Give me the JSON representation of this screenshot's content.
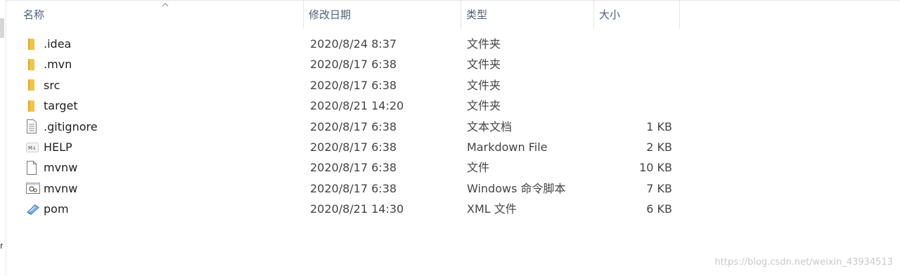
{
  "columns": {
    "name": "名称",
    "modified": "修改日期",
    "type": "类型",
    "size": "大小"
  },
  "files": [
    {
      "name": ".idea",
      "modified": "2020/8/24 8:37",
      "type": "文件夹",
      "size": "",
      "icon": "folder-icon"
    },
    {
      "name": ".mvn",
      "modified": "2020/8/17 6:38",
      "type": "文件夹",
      "size": "",
      "icon": "folder-icon"
    },
    {
      "name": "src",
      "modified": "2020/8/17 6:38",
      "type": "文件夹",
      "size": "",
      "icon": "folder-icon"
    },
    {
      "name": "target",
      "modified": "2020/8/21 14:20",
      "type": "文件夹",
      "size": "",
      "icon": "folder-icon"
    },
    {
      "name": ".gitignore",
      "modified": "2020/8/17 6:38",
      "type": "文本文档",
      "size": "1 KB",
      "icon": "text-document-icon"
    },
    {
      "name": "HELP",
      "modified": "2020/8/17 6:38",
      "type": "Markdown File",
      "size": "2 KB",
      "icon": "markdown-file-icon"
    },
    {
      "name": "mvnw",
      "modified": "2020/8/17 6:38",
      "type": "文件",
      "size": "10 KB",
      "icon": "blank-file-icon"
    },
    {
      "name": "mvnw",
      "modified": "2020/8/17 6:38",
      "type": "Windows 命令脚本",
      "size": "7 KB",
      "icon": "script-file-icon"
    },
    {
      "name": "pom",
      "modified": "2020/8/21 14:30",
      "type": "XML 文件",
      "size": "6 KB",
      "icon": "xml-file-icon"
    }
  ],
  "sort_indicator": "chevron-up-icon",
  "watermark": "https://blog.csdn.net/weixin_43934513",
  "colors": {
    "header_text": "#4c607a",
    "folder": "#f5c342",
    "row_text": "#3c3c3c"
  }
}
